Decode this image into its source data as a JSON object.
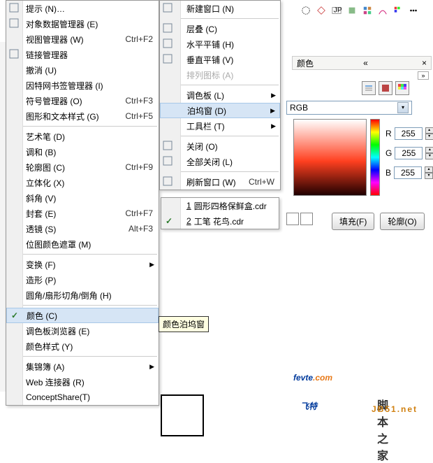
{
  "menu1": {
    "items": [
      {
        "label": "提示 (N)…",
        "icon": true
      },
      {
        "label": "对象数据管理器 (E)",
        "icon": true
      },
      {
        "label": "视图管理器 (W)",
        "shortcut": "Ctrl+F2"
      },
      {
        "label": "链接管理器",
        "icon": true
      },
      {
        "label": "撤消 (U)"
      },
      {
        "label": "因特网书签管理器 (I)"
      },
      {
        "label": "符号管理器 (O)",
        "shortcut": "Ctrl+F3"
      },
      {
        "label": "图形和文本样式 (G)",
        "shortcut": "Ctrl+F5"
      },
      {
        "sep": true
      },
      {
        "label": "艺术笔 (D)"
      },
      {
        "label": "调和 (B)"
      },
      {
        "label": "轮廓图 (C)",
        "shortcut": "Ctrl+F9"
      },
      {
        "label": "立体化 (X)"
      },
      {
        "label": "斜角 (V)"
      },
      {
        "label": "封套 (E)",
        "shortcut": "Ctrl+F7"
      },
      {
        "label": "透镜 (S)",
        "shortcut": "Alt+F3"
      },
      {
        "label": "位图颜色遮罩 (M)"
      },
      {
        "sep": true
      },
      {
        "label": "变换 (F)",
        "arrow": true
      },
      {
        "label": "造形 (P)"
      },
      {
        "label": "圆角/扇形切角/倒角 (H)"
      },
      {
        "sep": true
      },
      {
        "label": "颜色 (C)",
        "checked": true,
        "highlighted": true
      },
      {
        "label": "调色板浏览器 (E)"
      },
      {
        "label": "颜色样式 (Y)"
      },
      {
        "sep": true
      },
      {
        "label": "集锦簿 (A)",
        "arrow": true
      },
      {
        "label": "Web 连接器 (R)"
      },
      {
        "label": "ConceptShare(T)"
      }
    ]
  },
  "menu2": {
    "items": [
      {
        "label": "新建窗口 (N)",
        "icon": "new"
      },
      {
        "sep": true
      },
      {
        "label": "层叠 (C)",
        "icon": "cascade"
      },
      {
        "label": "水平平铺 (H)",
        "icon": "tileh"
      },
      {
        "label": "垂直平铺 (V)",
        "icon": "tilev"
      },
      {
        "label": "排列图标 (A)",
        "disabled": true
      },
      {
        "sep": true
      },
      {
        "label": "调色板 (L)",
        "arrow": true
      },
      {
        "label": "泊坞窗 (D)",
        "arrow": true,
        "highlighted": true
      },
      {
        "label": "工具栏 (T)",
        "arrow": true
      },
      {
        "sep": true
      },
      {
        "label": "关闭 (O)",
        "icon": "close"
      },
      {
        "label": "全部关闭 (L)",
        "icon": "closeall"
      },
      {
        "sep": true
      },
      {
        "label": "刷新窗口 (W)",
        "shortcut": "Ctrl+W",
        "icon": "refresh"
      }
    ]
  },
  "menu3": {
    "items": [
      {
        "label": "圆形四格保鲜盒.cdr",
        "prefix": "1"
      },
      {
        "label": "工笔 花鸟.cdr",
        "prefix": "2",
        "checked": true
      }
    ]
  },
  "tooltip": "颜色泊坞窗",
  "panel": {
    "title": "颜色",
    "model": "RGB",
    "r_label": "R",
    "r": "255",
    "g_label": "G",
    "g": "255",
    "b_label": "B",
    "b": "255",
    "fill_btn": "填充(F)",
    "outline_btn": "轮廓(O)"
  },
  "logos": {
    "fevte": "fevte",
    "com": ".com",
    "feite": "飞特",
    "sub1": "脚本之家",
    "sub2": "JB51.net"
  }
}
